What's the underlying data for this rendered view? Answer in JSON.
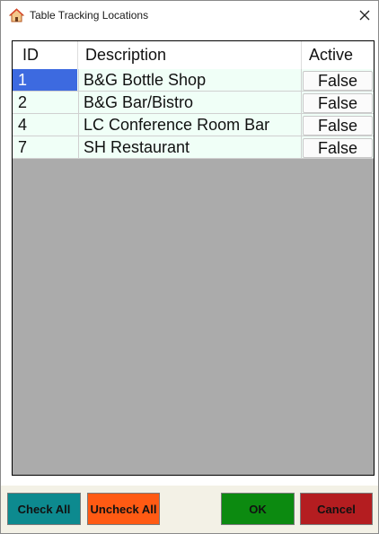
{
  "window": {
    "title": "Table Tracking Locations",
    "icon": "house-icon",
    "close_icon": "close-icon"
  },
  "grid": {
    "columns": [
      "ID",
      "Description",
      "Active"
    ],
    "rows": [
      {
        "id": "1",
        "description": "B&G Bottle Shop",
        "active": "False"
      },
      {
        "id": "2",
        "description": "B&G Bar/Bistro",
        "active": "False"
      },
      {
        "id": "4",
        "description": "LC Conference Room Bar",
        "active": "False"
      },
      {
        "id": "7",
        "description": "SH Restaurant",
        "active": "False"
      }
    ]
  },
  "buttons": {
    "check_all": "Check All",
    "uncheck_all": "Uncheck All",
    "ok": "OK",
    "cancel": "Cancel"
  },
  "colors": {
    "check_all": "#0d8a8f",
    "uncheck_all": "#ff5a13",
    "ok": "#0c8a10",
    "cancel": "#b41d20",
    "selected": "#3d6ae0",
    "grid_empty": "#ababab"
  }
}
